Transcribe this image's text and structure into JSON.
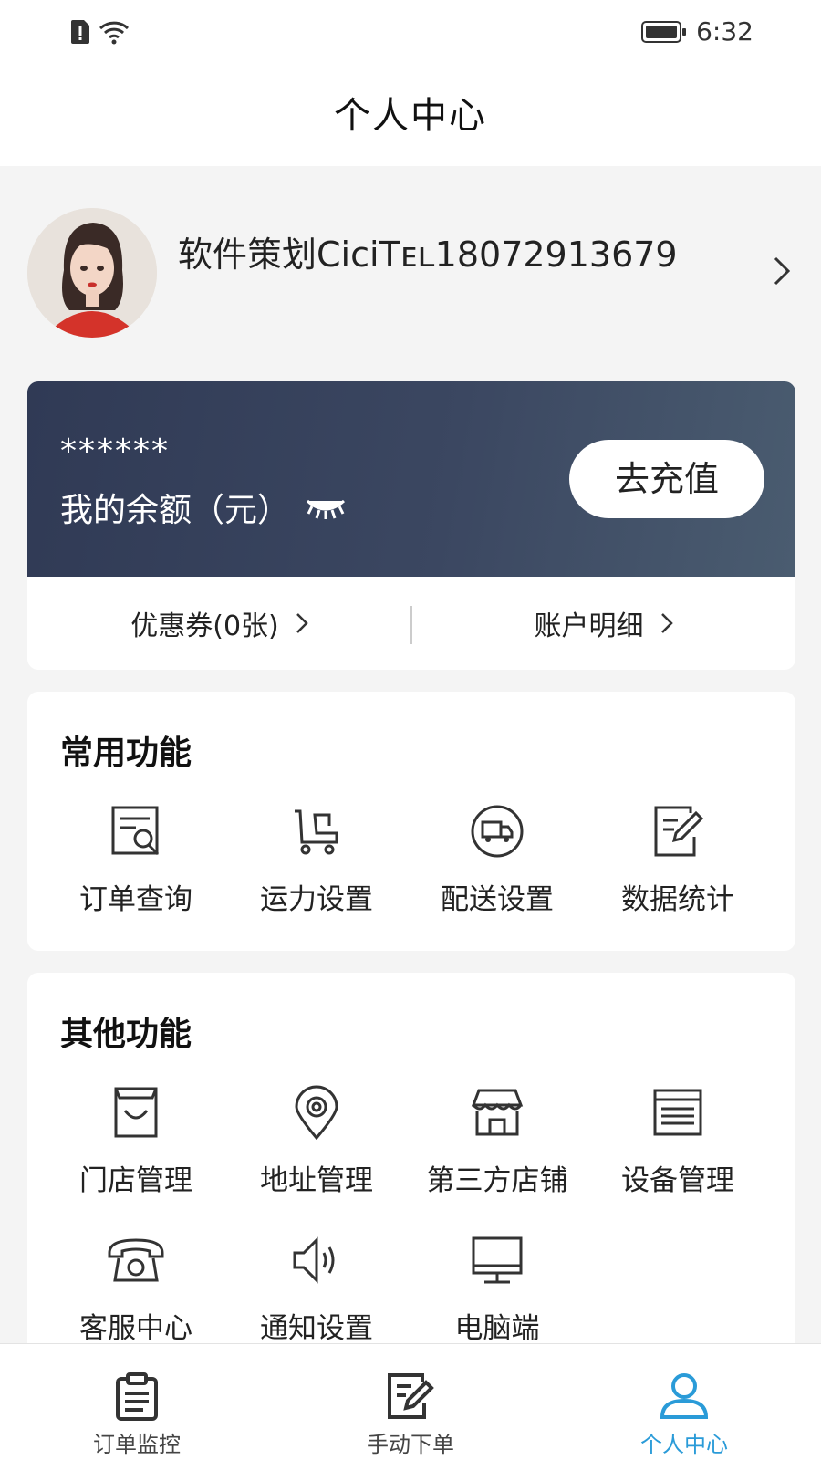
{
  "status_bar": {
    "time": "6:32"
  },
  "header": {
    "title": "个人中心"
  },
  "profile": {
    "name": "软件策划CiciTᴇʟ18072913679"
  },
  "balance": {
    "masked_amount": "******",
    "label": "我的余额（元）",
    "recharge_label": "去充值",
    "coupons_label": "优惠券(0张)",
    "account_detail_label": "账户明细"
  },
  "common": {
    "title": "常用功能",
    "items": [
      {
        "label": "订单查询",
        "icon": "order-search-icon"
      },
      {
        "label": "运力设置",
        "icon": "delivery-capacity-icon"
      },
      {
        "label": "配送设置",
        "icon": "truck-icon"
      },
      {
        "label": "数据统计",
        "icon": "edit-icon"
      }
    ]
  },
  "other": {
    "title": "其他功能",
    "items": [
      {
        "label": "门店管理",
        "icon": "shopping-bag-icon"
      },
      {
        "label": "地址管理",
        "icon": "location-pin-icon"
      },
      {
        "label": "第三方店铺",
        "icon": "storefront-icon"
      },
      {
        "label": "设备管理",
        "icon": "printer-icon"
      },
      {
        "label": "客服中心",
        "icon": "telephone-icon"
      },
      {
        "label": "通知设置",
        "icon": "speaker-icon"
      },
      {
        "label": "电脑端",
        "icon": "monitor-icon"
      }
    ]
  },
  "tabs": [
    {
      "label": "订单监控",
      "icon": "clipboard-icon"
    },
    {
      "label": "手动下单",
      "icon": "edit-document-icon"
    },
    {
      "label": "个人中心",
      "icon": "user-icon"
    }
  ],
  "colors": {
    "accent": "#2a9bd8",
    "card_dark": "#3b4761"
  }
}
